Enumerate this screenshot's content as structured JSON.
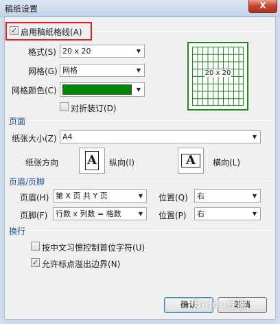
{
  "window": {
    "title": "稿纸设置",
    "close_label": "X"
  },
  "enable": {
    "label": "启用稿纸格线(A)",
    "checked_glyph": "✓"
  },
  "format": {
    "label": "格式(S)",
    "value": "20 x 20"
  },
  "grid_style": {
    "label": "网格(G)",
    "value": "网格"
  },
  "grid_color": {
    "label": "网格颜色(C)",
    "color": "#008800"
  },
  "fold_binding": {
    "label": "对折装订(D)"
  },
  "preview": {
    "label": "20 x 20"
  },
  "page_section": {
    "title": "页面"
  },
  "paper_size": {
    "label": "纸张大小(Z)",
    "value": "A4"
  },
  "orientation": {
    "label": "纸张方向",
    "portrait_label": "纵向(I)",
    "landscape_label": "横向(L)",
    "glyph": "A"
  },
  "header_footer_section": {
    "title": "页眉/页脚"
  },
  "header": {
    "label": "页眉(H)",
    "value": "第 X 页 共 Y 页",
    "position_label": "位置(Q)",
    "position_value": "右"
  },
  "footer": {
    "label": "页脚(F)",
    "value": "行数 x 列数 = 格数",
    "position_label": "位置(P)",
    "position_value": "右"
  },
  "wrap_section": {
    "title": "换行"
  },
  "wrap_options": {
    "chinese_rule_label": "按中文习惯控制首位字符(U)",
    "allow_overflow_label": "允许标点溢出边界(N)",
    "checked_glyph": "✓"
  },
  "buttons": {
    "ok_label": "确认",
    "cancel_label": "取消"
  },
  "watermark": "Baidu经验"
}
